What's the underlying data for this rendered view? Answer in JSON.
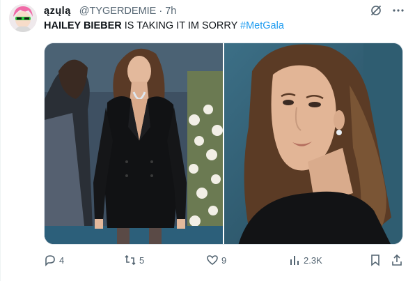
{
  "tweet": {
    "display_name": "ązųlą",
    "handle": "@TYGERDEMIE",
    "separator": "·",
    "time": "7h",
    "text_bold": "HAILEY BIEBER",
    "text_body": " IS TAKING IT IM SORRY ",
    "hashtag": "#MetGala"
  },
  "media": {
    "photos": [
      {
        "icon": "photo-full-length-black-blazer-dress"
      },
      {
        "icon": "photo-closeup-over-shoulder"
      }
    ]
  },
  "actions": {
    "replies": "4",
    "retweets": "5",
    "likes": "9",
    "views": "2.3K"
  },
  "colors": {
    "text": "#0f1419",
    "secondary": "#536471",
    "link": "#1d9bf0"
  }
}
